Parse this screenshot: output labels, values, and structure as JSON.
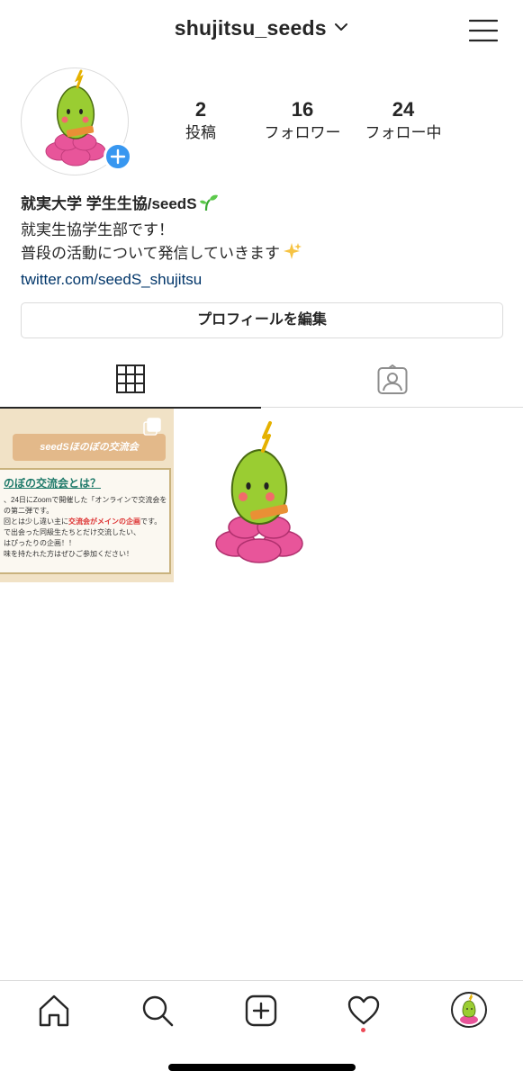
{
  "header": {
    "username": "shujitsu_seeds"
  },
  "stats": [
    {
      "count": "2",
      "label": "投稿"
    },
    {
      "count": "16",
      "label": "フォロワー"
    },
    {
      "count": "24",
      "label": "フォロー中"
    }
  ],
  "bio": {
    "display_name": "就実大学 学生生協/seedS",
    "line1": "就実生協学生部です！",
    "line2": "普段の活動について発信していきます",
    "link": "twitter.com/seedS_shujitsu"
  },
  "edit_profile_label": "プロフィールを編集",
  "posts": [
    {
      "banner": "seedSほのぼの交流会",
      "title": "のぼの交流会とは？",
      "lines": [
        "、24日にZoomで開催した「オンラインで交流会を",
        "の第二弾です。",
        "回とは少し違い主に",
        "で出会った同級生たちとだけ交流したい、",
        "はぴったりの企画！！",
        "味を持たれた方はぜひご参加ください！"
      ],
      "highlight": "交流会がメインの企画",
      "highlight_suffix": "です。"
    }
  ],
  "colors": {
    "accent_blue": "#3897f0",
    "link": "#003569",
    "notification_dot": "#ed4956",
    "border": "#dbdbdb"
  },
  "icons": {
    "menu": "hamburger-menu-icon",
    "grid": "grid-icon",
    "tagged": "tagged-person-icon",
    "home": "home-icon",
    "search": "search-icon",
    "new_post": "new-post-icon",
    "activity": "heart-icon"
  }
}
